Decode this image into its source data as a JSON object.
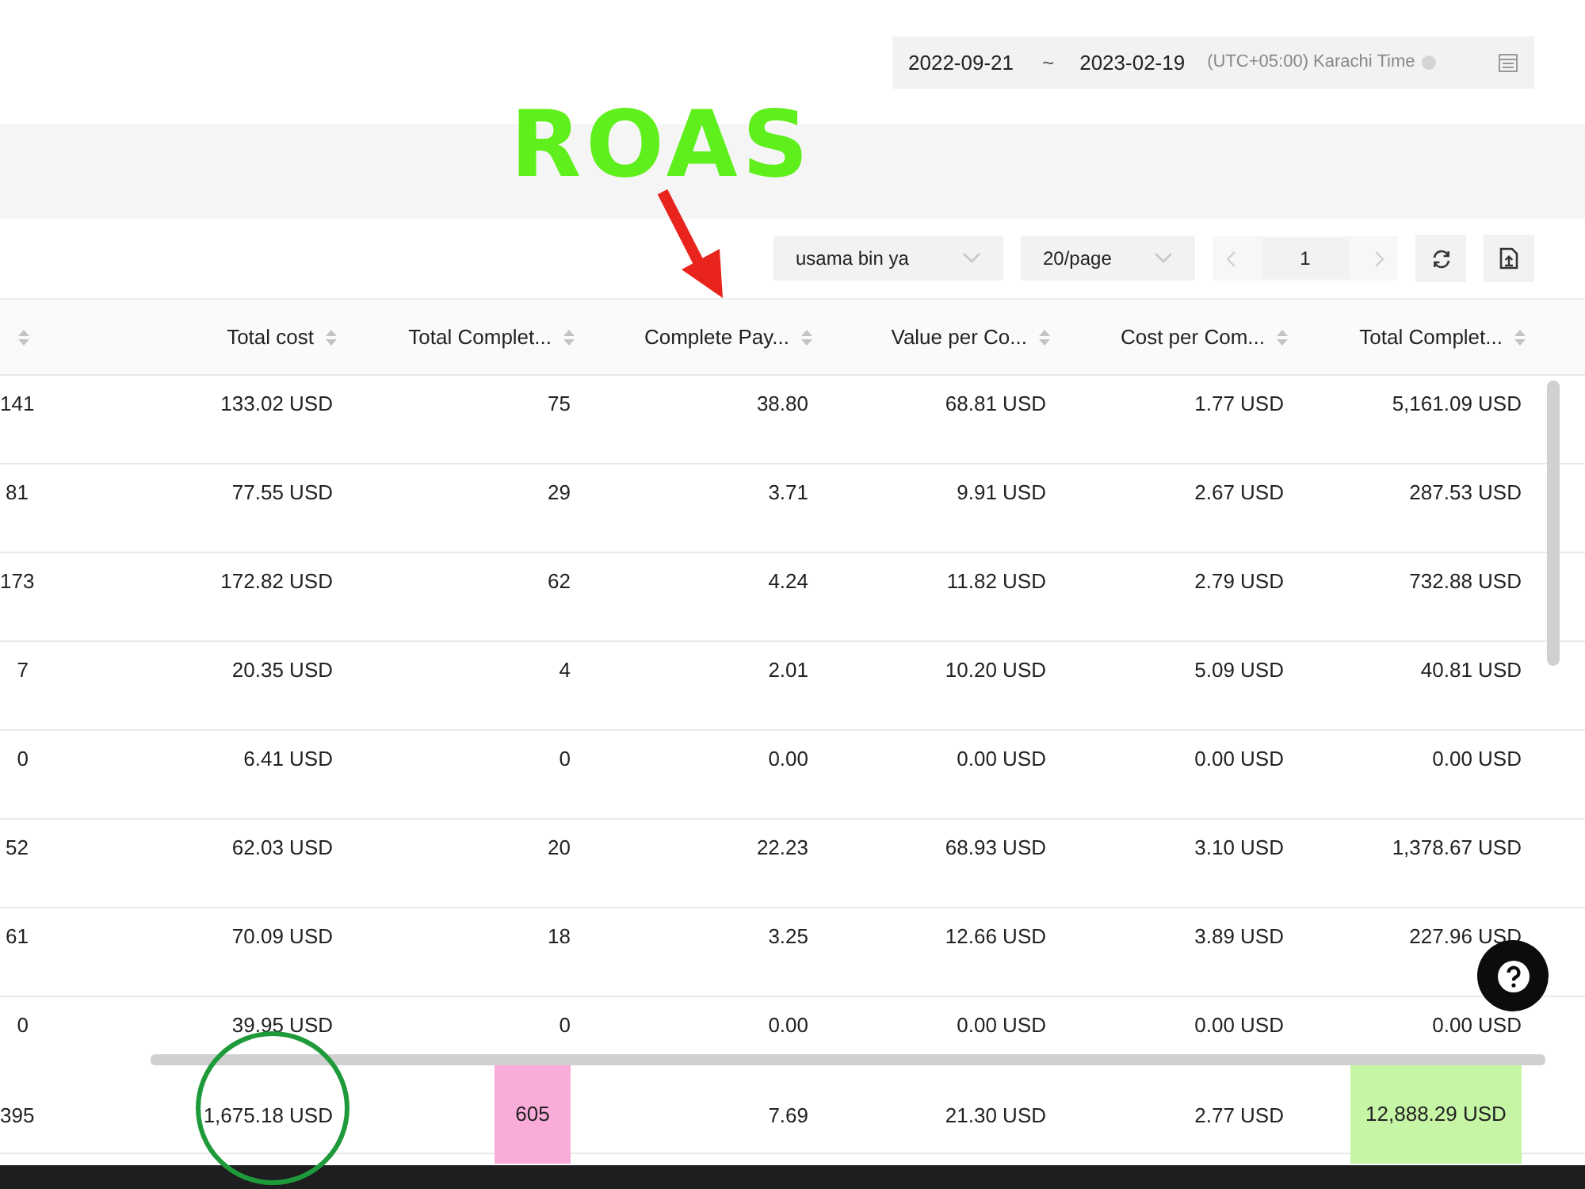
{
  "date_range": {
    "start": "2022-09-21",
    "separator": "~",
    "end": "2023-02-19",
    "timezone": "(UTC+05:00) Karachi Time"
  },
  "toolbar": {
    "account": "usama bin ya",
    "page_size": "20/page",
    "page": "1"
  },
  "annotation": {
    "title": "ROAS"
  },
  "table": {
    "columns": [
      "",
      "Total cost",
      "Total Complet...",
      "Complete Pay...",
      "Value per Co...",
      "Cost per Com...",
      "Total Complet..."
    ],
    "rows": [
      {
        "cells": [
          "141",
          "133.02 USD",
          "75",
          "38.80",
          "68.81 USD",
          "1.77 USD",
          "5,161.09 USD"
        ]
      },
      {
        "cells": [
          "81",
          "77.55 USD",
          "29",
          "3.71",
          "9.91 USD",
          "2.67 USD",
          "287.53 USD"
        ]
      },
      {
        "cells": [
          "173",
          "172.82 USD",
          "62",
          "4.24",
          "11.82 USD",
          "2.79 USD",
          "732.88 USD"
        ]
      },
      {
        "cells": [
          "7",
          "20.35 USD",
          "4",
          "2.01",
          "10.20 USD",
          "5.09 USD",
          "40.81 USD"
        ]
      },
      {
        "cells": [
          "0",
          "6.41 USD",
          "0",
          "0.00",
          "0.00 USD",
          "0.00 USD",
          "0.00 USD"
        ]
      },
      {
        "cells": [
          "52",
          "62.03 USD",
          "20",
          "22.23",
          "68.93 USD",
          "3.10 USD",
          "1,378.67 USD"
        ]
      },
      {
        "cells": [
          "61",
          "70.09 USD",
          "18",
          "3.25",
          "12.66 USD",
          "3.89 USD",
          "227.96 USD"
        ]
      },
      {
        "cells": [
          "0",
          "39.95 USD",
          "0",
          "0.00",
          "0.00 USD",
          "0.00 USD",
          "0.00 USD"
        ]
      }
    ],
    "summary": [
      {
        "text": "395"
      },
      {
        "text": "1,675.18 USD",
        "circled": true
      },
      {
        "text": "605",
        "color": "#f9acd8"
      },
      {
        "text": "7.69"
      },
      {
        "text": "21.30 USD"
      },
      {
        "text": "2.77 USD"
      },
      {
        "text": "12,888.29 USD",
        "color": "#c6f5a6"
      }
    ]
  }
}
